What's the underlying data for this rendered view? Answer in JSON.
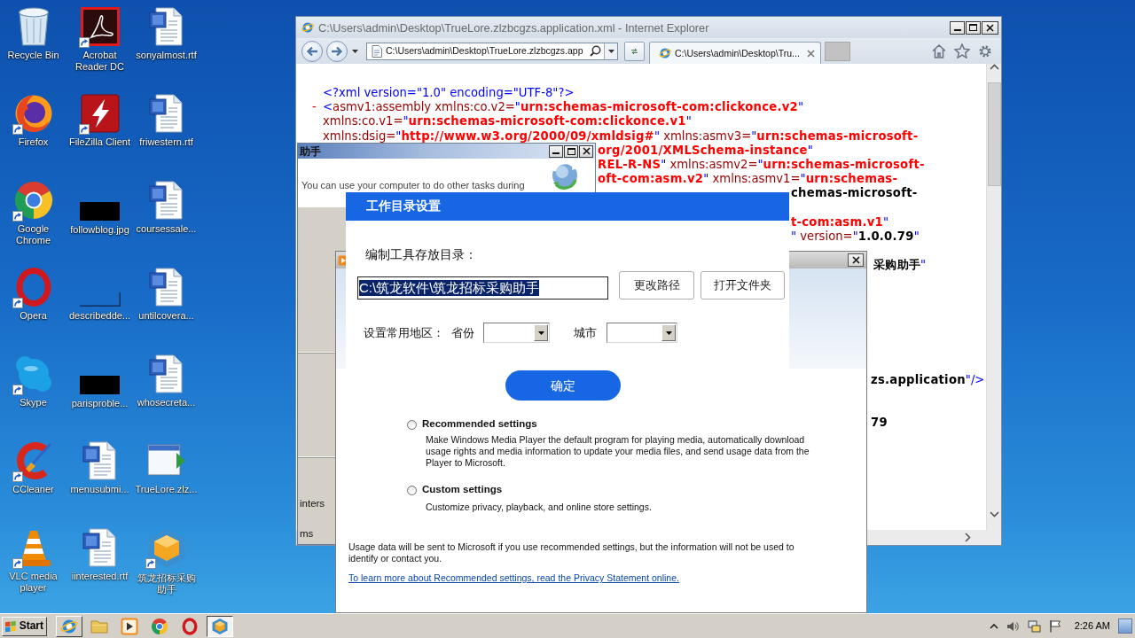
{
  "desktop": {
    "icons": [
      {
        "label": "Recycle Bin",
        "kind": "recyclebin",
        "shortcut": false
      },
      {
        "label": "Firefox",
        "kind": "firefox",
        "shortcut": true
      },
      {
        "label": "Google Chrome",
        "kind": "chrome",
        "shortcut": true
      },
      {
        "label": "Opera",
        "kind": "opera",
        "shortcut": true
      },
      {
        "label": "Skype",
        "kind": "skype",
        "shortcut": true
      },
      {
        "label": "CCleaner",
        "kind": "ccleaner",
        "shortcut": true
      },
      {
        "label": "VLC media player",
        "kind": "vlc",
        "shortcut": true
      },
      {
        "label": "Acrobat Reader DC",
        "kind": "acrobat",
        "shortcut": true
      },
      {
        "label": "FileZilla Client",
        "kind": "filezilla",
        "shortcut": true
      },
      {
        "label": "followblog.jpg",
        "kind": "thumbnail",
        "shortcut": false
      },
      {
        "label": "describedde...",
        "kind": "blankimage",
        "shortcut": false
      },
      {
        "label": "parisproble...",
        "kind": "thumbnail",
        "shortcut": false
      },
      {
        "label": "menusubmi...",
        "kind": "document",
        "shortcut": false
      },
      {
        "label": "iinterested.rtf",
        "kind": "document",
        "shortcut": false
      },
      {
        "label": "sonyalmost.rtf",
        "kind": "document",
        "shortcut": false
      },
      {
        "label": "friwestern.rtf",
        "kind": "document",
        "shortcut": false
      },
      {
        "label": "coursessale...",
        "kind": "document",
        "shortcut": false
      },
      {
        "label": "untilcovera...",
        "kind": "document",
        "shortcut": false
      },
      {
        "label": "whosecreta...",
        "kind": "document",
        "shortcut": false
      },
      {
        "label": "TrueLore.zlz...",
        "kind": "appwindow",
        "shortcut": false
      },
      {
        "label": "筑龙招标采购助手",
        "kind": "cube",
        "shortcut": true
      }
    ]
  },
  "browser": {
    "title": "C:\\Users\\admin\\Desktop\\TrueLore.zlzbcgzs.application.xml - Internet Explorer",
    "address": "C:\\Users\\admin\\Desktop\\TrueLore.zlzbcgzs.app",
    "tab": "C:\\Users\\admin\\Desktop\\Tru...",
    "xml_lines": [
      {
        "parts": [
          {
            "kind": "pi",
            "text": "<?xml version=\"1.0\" encoding=\"UTF-8\"?>"
          }
        ]
      },
      {
        "toggle": "-",
        "parts": [
          {
            "kind": "mark",
            "text": "<"
          },
          {
            "kind": "name",
            "text": "asmv1:assembly xmlns:co.v2="
          },
          {
            "kind": "mark",
            "text": "\""
          },
          {
            "kind": "ns",
            "text": "urn:schemas-microsoft-com:clickonce.v2"
          },
          {
            "kind": "mark",
            "text": "\""
          }
        ]
      },
      {
        "parts": [
          {
            "kind": "name",
            "text": "xmlns:co.v1="
          },
          {
            "kind": "mark",
            "text": "\""
          },
          {
            "kind": "ns",
            "text": "urn:schemas-microsoft-com:clickonce.v1"
          },
          {
            "kind": "mark",
            "text": "\""
          }
        ]
      },
      {
        "parts": [
          {
            "kind": "name",
            "text": "xmlns:dsig="
          },
          {
            "kind": "mark",
            "text": "\""
          },
          {
            "kind": "ns",
            "text": "http://www.w3.org/2000/09/xmldsig#"
          },
          {
            "kind": "mark",
            "text": "\""
          },
          {
            "kind": "name",
            "text": " xmlns:asmv3="
          },
          {
            "kind": "mark",
            "text": "\""
          },
          {
            "kind": "ns",
            "text": "urn:schemas-microsoft-"
          }
        ]
      },
      {
        "parts": [
          {
            "kind": "ns",
            "text": "org/2001/XMLSchema-instance"
          },
          {
            "kind": "mark",
            "text": "\""
          }
        ]
      },
      {
        "parts": [
          {
            "kind": "ns",
            "text": "REL-R-NS"
          },
          {
            "kind": "mark",
            "text": "\""
          },
          {
            "kind": "name",
            "text": " xmlns:asmv2="
          },
          {
            "kind": "mark",
            "text": "\""
          },
          {
            "kind": "ns",
            "text": "urn:schemas-microsoft-"
          }
        ]
      },
      {
        "parts": [
          {
            "kind": "ns",
            "text": "oft-com:asm.v2"
          },
          {
            "kind": "mark",
            "text": "\""
          },
          {
            "kind": "name",
            "text": " xmlns:asmv1="
          },
          {
            "kind": "mark",
            "text": "\""
          },
          {
            "kind": "ns",
            "text": "urn:schemas-"
          }
        ]
      },
      {
        "parts": [
          {
            "kind": "value",
            "text": "chemas-microsoft-"
          }
        ]
      },
      {
        "parts": [
          {
            "kind": "ns",
            "text": "t-com:asm.v1"
          },
          {
            "kind": "mark",
            "text": "\""
          }
        ]
      },
      {
        "parts": [
          {
            "kind": "mark",
            "text": "\""
          },
          {
            "kind": "name",
            "text": " version="
          },
          {
            "kind": "mark",
            "text": "\""
          },
          {
            "kind": "value",
            "text": "1.0.0.79"
          },
          {
            "kind": "mark",
            "text": "\""
          }
        ]
      },
      {
        "parts": [
          {
            "kind": "value",
            "text": "采购助手"
          },
          {
            "kind": "mark",
            "text": "\""
          }
        ]
      },
      {
        "parts": [
          {
            "kind": "value",
            "text": "zs.application"
          },
          {
            "kind": "mark",
            "text": "\"/>"
          }
        ]
      },
      {
        "parts": [
          {
            "kind": "value",
            "text": "79"
          }
        ]
      }
    ]
  },
  "installer": {
    "title": "助手",
    "message": "You can use your computer to do other tasks during",
    "fragments": [
      "inters",
      "ms"
    ]
  },
  "media_player": {
    "options": [
      {
        "label": "Recommended settings",
        "description": "Make Windows Media Player the default program for playing media, automatically download usage rights and media information to update your media files, and send usage data from the Player to Microsoft.",
        "selected": false
      },
      {
        "label": "Custom settings",
        "description": "Customize privacy, playback, and online store settings.",
        "selected": false
      }
    ],
    "notice": "Usage data will be sent to Microsoft if you use recommended settings, but the information will not be used to identify or contact you.",
    "link": "To learn more about Recommended settings, read the Privacy Statement online."
  },
  "settings_dialog": {
    "title": "工作目录设置",
    "path_label": "编制工具存放目录：",
    "path": "C:\\筑龙软件\\筑龙招标采购助手",
    "path_selected": true,
    "buttons": [
      "更改路径",
      "打开文件夹"
    ],
    "region_label": "设置常用地区：",
    "province_label": "省份",
    "city_label": "城市",
    "confirm": "确定"
  },
  "taskbar": {
    "start": "Start",
    "items": [
      {
        "kind": "ie",
        "open": true,
        "selected": false
      },
      {
        "kind": "folder",
        "open": false,
        "selected": false
      },
      {
        "kind": "player",
        "open": false,
        "selected": false
      },
      {
        "kind": "chrome",
        "open": false,
        "selected": false
      },
      {
        "kind": "opera",
        "open": false,
        "selected": false
      },
      {
        "kind": "cube",
        "open": true,
        "selected": true
      }
    ],
    "clock": "2:26 AM"
  }
}
